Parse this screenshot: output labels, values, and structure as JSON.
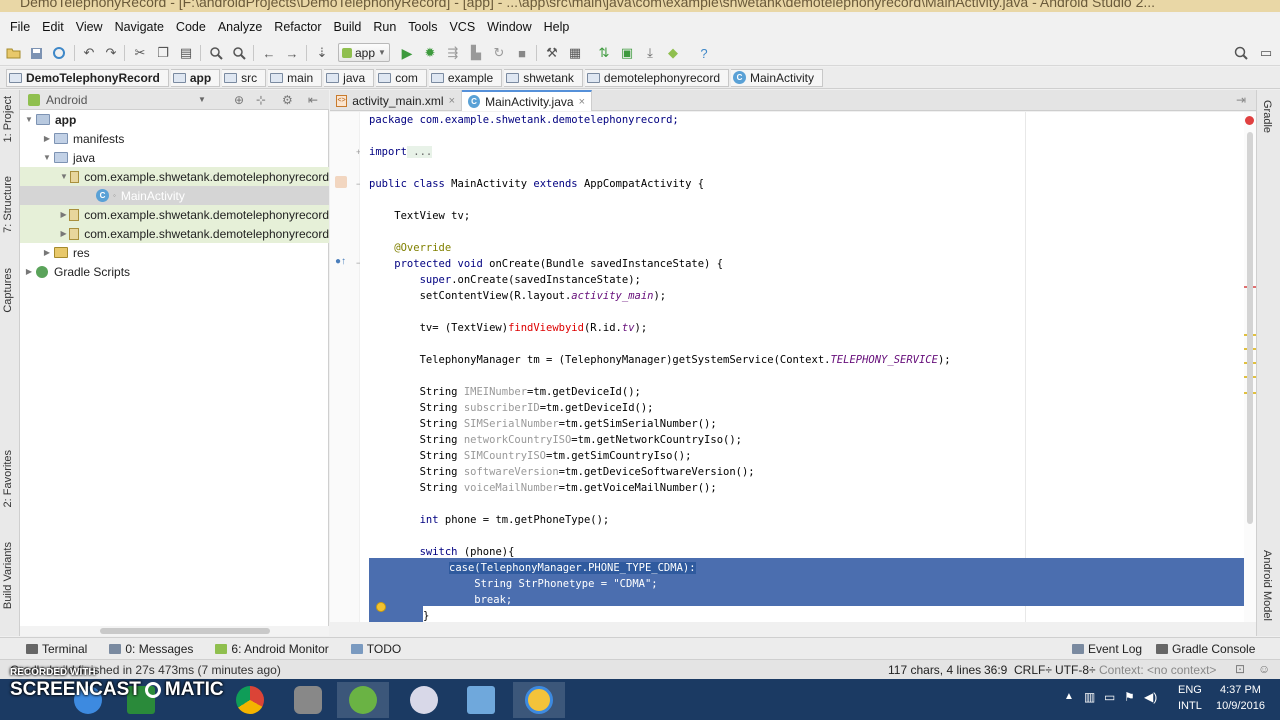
{
  "window": {
    "title": "DemoTelephonyRecord - [F:\\androidProjects\\DemoTelephonyRecord] - [app] - ...\\app\\src\\main\\java\\com\\example\\shwetank\\demotelephonyrecord\\MainActivity.java - Android Studio 2..."
  },
  "menu": [
    "File",
    "Edit",
    "View",
    "Navigate",
    "Code",
    "Analyze",
    "Refactor",
    "Build",
    "Run",
    "Tools",
    "VCS",
    "Window",
    "Help"
  ],
  "toolbar": {
    "run_config": "app"
  },
  "breadcrumb": [
    "DemoTelephonyRecord",
    "app",
    "src",
    "main",
    "java",
    "com",
    "example",
    "shwetank",
    "demotelephonyrecord",
    "MainActivity"
  ],
  "left_tabs": {
    "project": "1: Project",
    "structure": "7: Structure",
    "captures": "Captures",
    "favorites": "2: Favorites",
    "build_variants": "Build Variants"
  },
  "right_tabs": {
    "gradle": "Gradle",
    "android_model": "Android Model"
  },
  "project_panel": {
    "view": "Android",
    "tree": [
      {
        "label": "app",
        "bold": true
      },
      {
        "label": "manifests"
      },
      {
        "label": "java"
      },
      {
        "label": "com.example.shwetank.demotelephonyrecord"
      },
      {
        "label": "MainActivity"
      },
      {
        "label": "com.example.shwetank.demotelephonyrecord"
      },
      {
        "label": "com.example.shwetank.demotelephonyrecord"
      },
      {
        "label": "res"
      },
      {
        "label": "Gradle Scripts"
      }
    ]
  },
  "editor_tabs": [
    {
      "label": "activity_main.xml",
      "active": false
    },
    {
      "label": "MainActivity.java",
      "active": true
    }
  ],
  "code": {
    "l1": "package com.example.shwetank.demotelephonyrecord;",
    "l2_kw": "import",
    "l2_rest": " ...",
    "l3_a": "public class",
    "l3_b": " MainActivity ",
    "l3_c": "extends",
    "l3_d": " AppCompatActivity {",
    "l4": "    TextView tv;",
    "l5": "    @Override",
    "l6_a": "    protected void",
    "l6_b": " onCreate(Bundle savedInstanceState) {",
    "l7_a": "        super",
    "l7_b": ".onCreate(savedInstanceState);",
    "l8_a": "        setContentView(R.layout.",
    "l8_b": "activity_main",
    "l8_c": ");",
    "l9_a": "        tv= (TextView)",
    "l9_b": "findViewbyid",
    "l9_c": "(R.id.",
    "l9_d": "tv",
    "l9_e": ");",
    "l10_a": "        TelephonyManager tm = (TelephonyManager)getSystemService(Context.",
    "l10_b": "TELEPHONY_SERVICE",
    "l10_c": ");",
    "s1_v": "IMEINumber",
    "s1_r": "=tm.getDeviceId();",
    "s2_v": "subscriberID",
    "s2_r": "=tm.getDeviceId();",
    "s3_v": "SIMSerialNumber",
    "s3_r": "=tm.getSimSerialNumber();",
    "s4_v": "networkCountryISO",
    "s4_r": "=tm.getNetworkCountryIso();",
    "s5_v": "SIMCountryISO",
    "s5_r": "=tm.getSimCountryIso();",
    "s6_v": "softwareVersion",
    "s6_r": "=tm.getDeviceSoftwareVersion();",
    "s7_v": "voiceMailNumber",
    "s7_r": "=tm.getVoiceMailNumber();",
    "string_kw": "        String ",
    "l11_a": "        int",
    "l11_b": " phone = tm.getPhoneType();",
    "l12_a": "        switch",
    "l12_b": " (phone){",
    "l13": "case(TelephonyManager.PHONE_TYPE_CDMA):",
    "l14": "    String StrPhonetype = \"CDMA\";",
    "l15": "    break;",
    "l16": "}"
  },
  "bottom_tabs": [
    {
      "label": "Terminal"
    },
    {
      "label": "0: Messages"
    },
    {
      "label": "6: Android Monitor"
    },
    {
      "label": "TODO"
    }
  ],
  "bottom_right_tabs": [
    {
      "label": "Event Log"
    },
    {
      "label": "Gradle Console"
    }
  ],
  "status": {
    "message": "Gradle build finished in 27s 473ms (7 minutes ago)",
    "chars": "117 chars, 4 lines",
    "position": "36:9",
    "line_sep": "CRLF÷",
    "encoding": "UTF-8÷",
    "context": "Context: <no context>"
  },
  "watermark": {
    "line1": "RECORDED WITH",
    "line2": "SCREENCAST",
    "line3": "MATIC"
  },
  "tray": {
    "lang": "ENG",
    "locale": "INTL",
    "time": "4:37 PM",
    "date": "10/9/2016"
  },
  "colors": {
    "selection": "#4b6eaf",
    "keyword": "#000080",
    "annotation": "#808000",
    "field": "#660e7a",
    "taskbar": "#1b3a63"
  }
}
